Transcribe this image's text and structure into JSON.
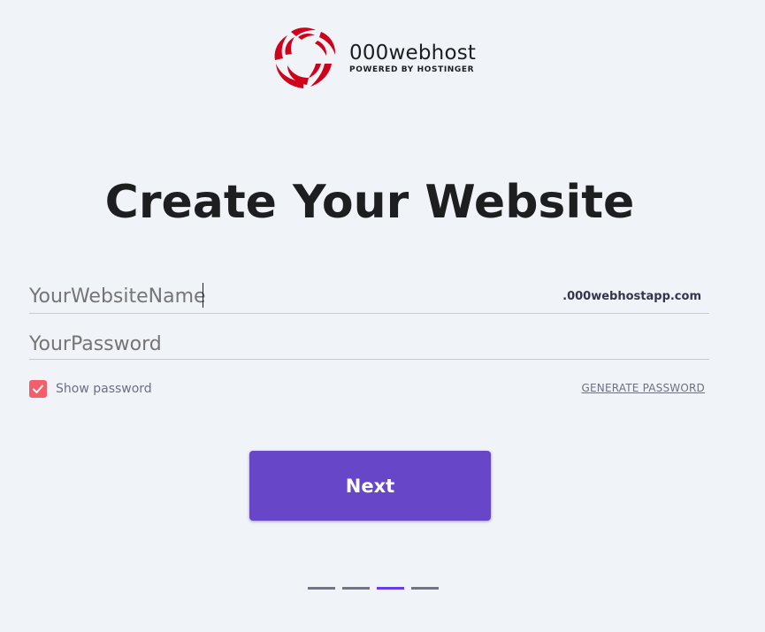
{
  "brand": {
    "name": "000webhost",
    "tagline": "POWERED BY HOSTINGER",
    "logo_icon": "spiral-logo-icon",
    "logo_color": "#d0021b"
  },
  "title": "Create Your Website",
  "form": {
    "website_name": {
      "value": "",
      "placeholder": "YourWebsiteName",
      "suffix": ".000webhostapp.com"
    },
    "password": {
      "value": "",
      "placeholder": "YourPassword"
    },
    "show_password": {
      "label": "Show password",
      "checked": true,
      "check_icon": "checkmark-icon"
    },
    "generate_password_label": "GENERATE PASSWORD"
  },
  "next_button_label": "Next",
  "progress": {
    "total_steps": 4,
    "current_step": 3
  },
  "colors": {
    "accent": "#673de6",
    "checkbox": "#f45d6a",
    "background": "#f0f3f7",
    "text": "#1d1e20"
  }
}
